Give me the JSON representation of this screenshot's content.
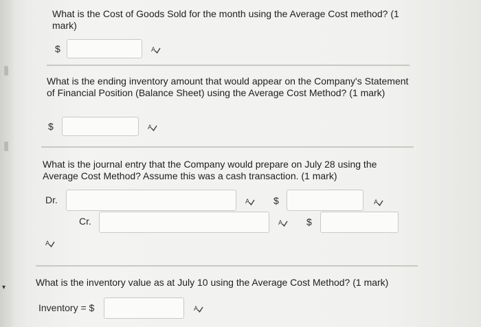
{
  "questions": [
    {
      "text": "What is the Cost of Goods Sold for the month using the Average Cost method? (1 mark)",
      "currency": "$",
      "value": ""
    },
    {
      "text": "What is the ending inventory amount that would appear on the Company's Statement of Financial Position (Balance Sheet) using the Average Cost Method? (1 mark)",
      "currency": "$",
      "value": ""
    },
    {
      "text": "What is the journal entry that the Company would prepare on July 28 using the Average Cost Method? Assume this was a cash transaction. (1 mark)",
      "debit_label": "Dr.",
      "credit_label": "Cr.",
      "currency": "$",
      "debit_account": "",
      "debit_amount": "",
      "credit_account": "",
      "credit_amount": ""
    },
    {
      "text": "What is the inventory value as at July 10 using the Average Cost Method? (1 mark)",
      "prefix": "Inventory = $",
      "value": ""
    }
  ],
  "icons": {
    "spell_check": "spell-check-icon",
    "scroll_arrow": "caret-down-icon"
  },
  "colors": {
    "text": "#1e1e1e",
    "field_border": "#c9c9c6",
    "field_bg": "#fbfbfa",
    "rule": "#c8c8c4"
  }
}
